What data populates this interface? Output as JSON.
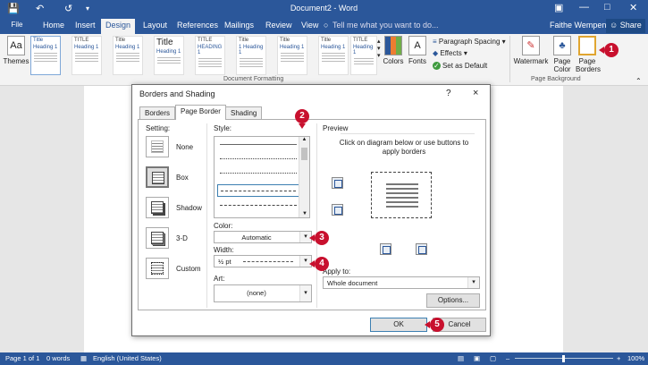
{
  "window": {
    "title": "Document2 - Word"
  },
  "qat": {
    "save_icon": "save-icon",
    "undo_icon": "undo-icon",
    "redo_icon": "redo-icon"
  },
  "ribbon_tabs": [
    "File",
    "Home",
    "Insert",
    "Design",
    "Layout",
    "References",
    "Mailings",
    "Review",
    "View"
  ],
  "active_tab": "Design",
  "tell_me": "Tell me what you want to do...",
  "user": "Faithe Wempen",
  "share": "Share",
  "ribbon": {
    "themes_label": "Themes",
    "style_thumbs": [
      {
        "title": "Title",
        "sub": "Heading 1"
      },
      {
        "title": "TITLE",
        "sub": "Heading 1"
      },
      {
        "title": "Title",
        "sub": "Heading 1"
      },
      {
        "title": "Title",
        "sub": "Heading 1"
      },
      {
        "title": "TITLE",
        "sub": "HEADING 1"
      },
      {
        "title": "Title",
        "sub": "1 Heading 1"
      },
      {
        "title": "Title",
        "sub": "Heading 1"
      },
      {
        "title": "Title",
        "sub": "Heading 1"
      },
      {
        "title": "TITLE",
        "sub": "Heading 1"
      }
    ],
    "doc_formatting_label": "Document Formatting",
    "colors_label": "Colors",
    "fonts_label": "Fonts",
    "paragraph_spacing": "Paragraph Spacing",
    "effects": "Effects",
    "set_as_default": "Set as Default",
    "watermark": "Watermark",
    "page_color": "Page Color",
    "page_borders": "Page Borders",
    "page_background_label": "Page Background"
  },
  "dialog": {
    "title": "Borders and Shading",
    "help": "?",
    "close": "×",
    "tabs": [
      "Borders",
      "Page Border",
      "Shading"
    ],
    "active_tab": "Page Border",
    "setting_label": "Setting:",
    "settings": [
      "None",
      "Box",
      "Shadow",
      "3-D",
      "Custom"
    ],
    "selected_setting": "Box",
    "style_label": "Style:",
    "color_label": "Color:",
    "color_value": "Automatic",
    "width_label": "Width:",
    "width_value": "½ pt",
    "art_label": "Art:",
    "art_value": "(none)",
    "preview_label": "Preview",
    "preview_hint": "Click on diagram below or use buttons to apply borders",
    "apply_to_label": "Apply to:",
    "apply_to_value": "Whole document",
    "options_button": "Options...",
    "ok_button": "OK",
    "cancel_button": "Cancel"
  },
  "callouts": [
    "1",
    "2",
    "3",
    "4",
    "5"
  ],
  "status": {
    "page": "Page 1 of 1",
    "words": "0 words",
    "language": "English (United States)",
    "zoom": "100%"
  },
  "colors": {
    "word_blue": "#2b579a",
    "callout_red": "#c8102e"
  }
}
